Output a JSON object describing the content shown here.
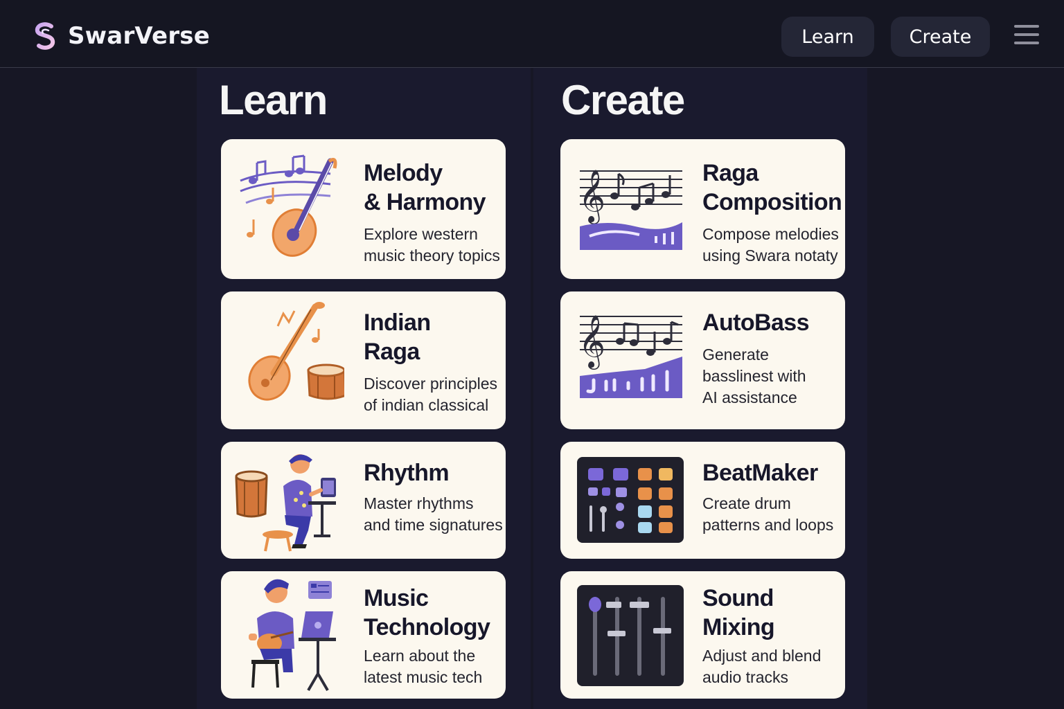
{
  "app": {
    "name": "SwarVerse"
  },
  "nav": {
    "learn_label": "Learn",
    "create_label": "Create"
  },
  "learn": {
    "heading": "Learn",
    "cards": [
      {
        "title_lines": [
          "Melody",
          "& Harmony"
        ],
        "desc_lines": [
          "Explore western",
          "music theory topics"
        ]
      },
      {
        "title_lines": [
          "Indian",
          "Raga"
        ],
        "desc_lines": [
          "Discover principles",
          "of indian classical"
        ]
      },
      {
        "title_lines": [
          "Rhythm"
        ],
        "desc_lines": [
          "Master rhythms",
          "and time signatures"
        ]
      },
      {
        "title_lines": [
          "Music",
          "Technology"
        ],
        "desc_lines": [
          "Learn about the",
          "latest music tech"
        ]
      }
    ]
  },
  "create": {
    "heading": "Create",
    "cards": [
      {
        "title_lines": [
          "Raga",
          "Composition"
        ],
        "desc_lines": [
          "Compose melodies",
          "using Swara notaty"
        ]
      },
      {
        "title_lines": [
          "AutoBass"
        ],
        "desc_lines": [
          "Generate",
          "basslinest with",
          "AI assistance"
        ]
      },
      {
        "title_lines": [
          "BeatMaker"
        ],
        "desc_lines": [
          "Create drum",
          "patterns and loops"
        ]
      },
      {
        "title_lines": [
          "Sound",
          "Mixing"
        ],
        "desc_lines": [
          "Adjust and blend",
          "audio tracks"
        ]
      }
    ]
  },
  "colors": {
    "bg": "#171725",
    "card": "#fcf8ef",
    "accent": "#6b5bc4",
    "orange": "#e8914a"
  },
  "icons": {
    "logo": "swarverse-logo-icon",
    "menu": "hamburger-menu-icon"
  }
}
